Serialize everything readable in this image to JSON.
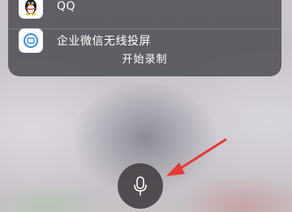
{
  "apps": [
    {
      "label": "QQ",
      "icon": "qq-penguin-icon"
    },
    {
      "label": "企业微信无线投屏",
      "icon": "wecom-screencast-icon"
    }
  ],
  "panel": {
    "action_label": "开始录制"
  },
  "mic": {
    "icon": "microphone-icon"
  },
  "annotation": {
    "icon": "red-arrow-icon",
    "color": "#e53935"
  }
}
